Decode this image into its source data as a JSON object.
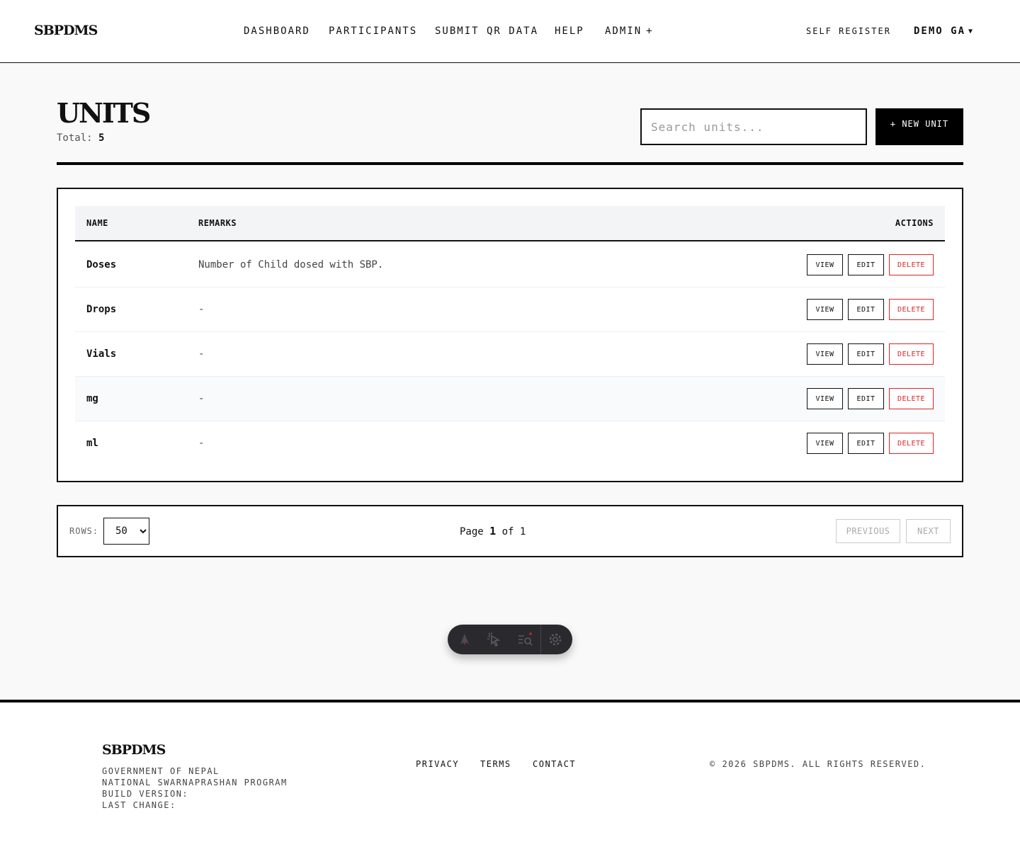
{
  "header": {
    "brand": "SBPDMS",
    "nav": [
      {
        "label": "DASHBOARD"
      },
      {
        "label": "PARTICIPANTS"
      },
      {
        "label": "SUBMIT QR DATA"
      },
      {
        "label": "HELP"
      },
      {
        "label": "ADMIN",
        "suffix": "+"
      }
    ],
    "self_register": "SELF REGISTER",
    "user_name": "DEMO GA",
    "user_caret": "▼"
  },
  "page": {
    "title": "UNITS",
    "total_label": "Total:",
    "total_value": "5",
    "search_placeholder": "Search units...",
    "new_button": "+ NEW UNIT"
  },
  "table": {
    "headers": {
      "name": "NAME",
      "remarks": "REMARKS",
      "actions": "ACTIONS"
    },
    "rows": [
      {
        "name": "Doses",
        "remarks": "Number of Child dosed with SBP."
      },
      {
        "name": "Drops",
        "remarks": "-"
      },
      {
        "name": "Vials",
        "remarks": "-"
      },
      {
        "name": "mg",
        "remarks": "-"
      },
      {
        "name": "ml",
        "remarks": "-"
      }
    ],
    "action_labels": {
      "view": "VIEW",
      "edit": "EDIT",
      "delete": "DELETE"
    }
  },
  "pagination": {
    "rows_label": "ROWS:",
    "rows_value": "50",
    "page_word": "Page",
    "current_page": "1",
    "of_word": "of",
    "total_pages": "1",
    "previous": "PREVIOUS",
    "next": "NEXT"
  },
  "devbar": {
    "icons": [
      "astro-icon",
      "cursor-select-icon",
      "audit-search-icon",
      "gear-icon"
    ]
  },
  "footer": {
    "brand": "SBPDMS",
    "lines": [
      "GOVERNMENT OF NEPAL",
      "NATIONAL SWARNAPRASHAN PROGRAM",
      "BUILD VERSION:",
      "LAST CHANGE:"
    ],
    "links": [
      "PRIVACY",
      "TERMS",
      "CONTACT"
    ],
    "copyright": "© 2026 SBPDMS. ALL RIGHTS RESERVED."
  },
  "colors": {
    "accent": "#000000",
    "danger": "#dc2626",
    "page_bg": "#f9f9f9",
    "table_head_bg": "#f3f4f6"
  }
}
